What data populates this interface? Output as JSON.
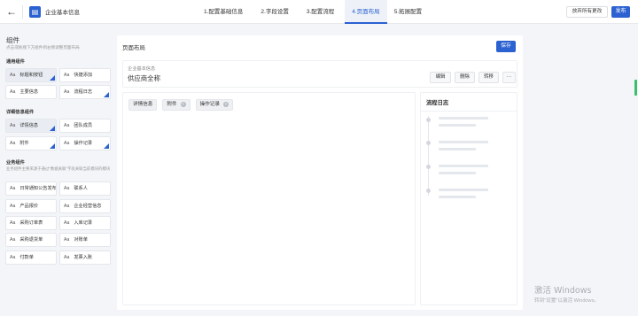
{
  "topbar": {
    "app_title": "企业基本信息",
    "steps": [
      "1.配置基础信息",
      "2.字段设置",
      "3.配置流程",
      "4.页面布局",
      "5.拓展配置"
    ],
    "active_step": "4.页面布局",
    "discard_label": "放弃所有更改",
    "publish_label": "发布"
  },
  "left": {
    "title": "组件",
    "hint": "点击或拖拽下方组件到右侧调整页面布局",
    "groups": [
      {
        "title": "通用组件",
        "items": [
          {
            "label": "标题和按钮",
            "used": true
          },
          {
            "label": "快捷添加",
            "used": false
          },
          {
            "label": "主要信息",
            "used": false
          },
          {
            "label": "流程日志",
            "used": true
          }
        ]
      },
      {
        "title": "详细信息组件",
        "items": [
          {
            "label": "详情信息",
            "used": true
          },
          {
            "label": "团队成员",
            "used": false
          },
          {
            "label": "附件",
            "used": true
          },
          {
            "label": "操作记录",
            "used": true
          }
        ]
      },
      {
        "title": "业务组件",
        "desc": "业务组件主要来源于通过\"数据关联\"字段关联当前模块的模块",
        "items": [
          {
            "label": "日常通知公告发布",
            "used": false
          },
          {
            "label": "联系人",
            "used": false
          },
          {
            "label": "产品报价",
            "used": false
          },
          {
            "label": "企业经营信息",
            "used": false
          },
          {
            "label": "采购订单表",
            "used": false
          },
          {
            "label": "入库记录",
            "used": false
          },
          {
            "label": "采购退货单",
            "used": false
          },
          {
            "label": "对账单",
            "used": false
          },
          {
            "label": "付款单",
            "used": false
          },
          {
            "label": "发票入账",
            "used": false
          }
        ]
      }
    ]
  },
  "main": {
    "title": "页面布局",
    "save_label": "保存",
    "header": {
      "subtitle": "企业基本信息",
      "title": "供应商全称",
      "buttons": [
        "编辑",
        "删除",
        "转移",
        "···"
      ]
    },
    "tabs": [
      {
        "label": "详情信息",
        "closable": false
      },
      {
        "label": "附件",
        "closable": true
      },
      {
        "label": "操作记录",
        "closable": true
      }
    ],
    "flow_title": "流程日志"
  },
  "system": {
    "activation_title": "激活 Windows",
    "activation_sub": "转到\"设置\"以激活 Windows。"
  },
  "colors": {
    "accent": "#2b61d1",
    "background": "#f3f5f8"
  }
}
